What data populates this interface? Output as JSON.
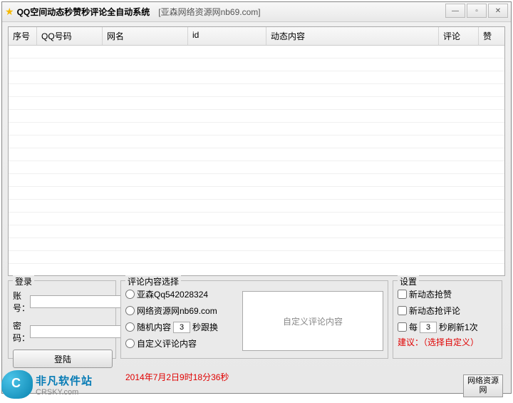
{
  "titlebar": {
    "title": "QQ空间动态秒赞秒评论全自动系统",
    "subtitle": "[亚森网络资源网nb69.com]"
  },
  "win": {
    "min": "—",
    "max": "▫",
    "close": "✕"
  },
  "table": {
    "headers": [
      "序号",
      "QQ号码",
      "网名",
      "id",
      "动态内容",
      "评论",
      "赞"
    ]
  },
  "login": {
    "group_title": "登录",
    "account_label": "账号：",
    "password_label": "密码：",
    "account_value": "",
    "password_value": "",
    "login_btn": "登陆"
  },
  "comment": {
    "group_title": "评论内容选择",
    "opt1": "亚森Qq542028324",
    "opt2": "网络资源网nb69.com",
    "opt3_prefix": "随机内容",
    "opt3_seconds": "3",
    "opt3_suffix": "秒跟换",
    "opt4": "自定义评论内容",
    "custom_placeholder": "自定义评论内容"
  },
  "timestamp": "2014年7月2日9时18分36秒",
  "settings": {
    "group_title": "设置",
    "chk1": "新动态抢赞",
    "chk2": "新动态抢评论",
    "chk3_prefix": "每",
    "chk3_seconds": "3",
    "chk3_suffix": "秒刷新1次",
    "advice": "建议：（选择自定义）"
  },
  "resource_btn": "网络资源网",
  "watermark": {
    "line1": "非凡软件站",
    "line2": "CRSKY.com"
  }
}
